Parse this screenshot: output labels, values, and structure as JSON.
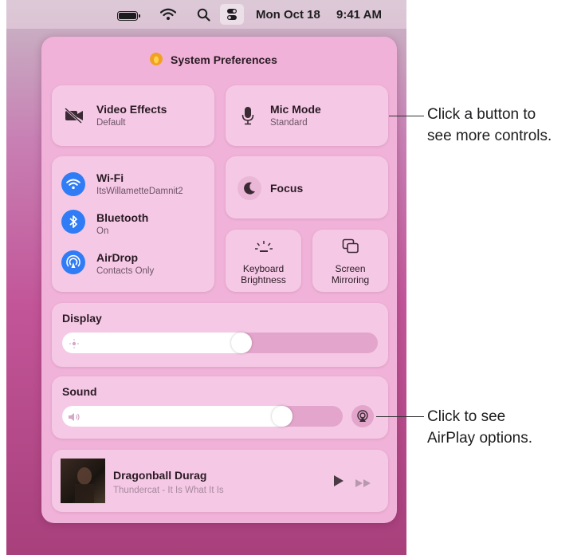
{
  "menubar": {
    "date": "Mon Oct 18",
    "time": "9:41 AM"
  },
  "panel": {
    "title": "System Preferences",
    "video_effects": {
      "label": "Video Effects",
      "sub": "Default"
    },
    "mic_mode": {
      "label": "Mic Mode",
      "sub": "Standard"
    },
    "wifi": {
      "label": "Wi-Fi",
      "sub": "ItsWillametteDamnit2"
    },
    "bluetooth": {
      "label": "Bluetooth",
      "sub": "On"
    },
    "airdrop": {
      "label": "AirDrop",
      "sub": "Contacts Only"
    },
    "focus": {
      "label": "Focus"
    },
    "keyboard_brightness": {
      "line1": "Keyboard",
      "line2": "Brightness"
    },
    "screen_mirroring": {
      "line1": "Screen",
      "line2": "Mirroring"
    },
    "display": {
      "label": "Display",
      "level": 0.6
    },
    "sound": {
      "label": "Sound",
      "level": 0.82
    },
    "now_playing": {
      "title": "Dragonball Durag",
      "artist": "Thundercat - It Is What It Is"
    }
  },
  "callouts": {
    "buttons_line1": "Click a button to",
    "buttons_line2": "see more controls.",
    "airplay_line1": "Click to see",
    "airplay_line2": "AirPlay options."
  },
  "colors": {
    "accent_blue": "#2f7cf6",
    "panel": "#f0b2d8",
    "tile": "#f5c9e5"
  },
  "icons": [
    "battery-icon",
    "wifi-icon",
    "search-icon",
    "control-center-icon",
    "system-preferences-icon",
    "video-off-icon",
    "microphone-icon",
    "wifi-icon",
    "bluetooth-icon",
    "airdrop-icon",
    "moon-icon",
    "keyboard-brightness-icon",
    "screen-mirroring-icon",
    "sun-icon",
    "speaker-icon",
    "airplay-icon",
    "play-icon",
    "forward-icon"
  ]
}
